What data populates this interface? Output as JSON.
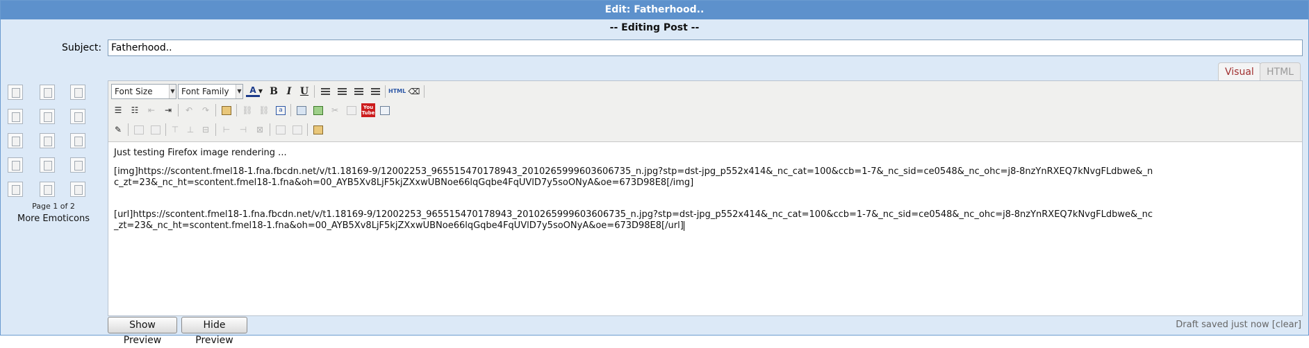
{
  "window": {
    "title": "Edit: Fatherhood.."
  },
  "header": {
    "subtitle": "-- Editing Post --"
  },
  "subject": {
    "label": "Subject:",
    "value": "Fatherhood.."
  },
  "tabs": [
    {
      "label": "Visual",
      "active": true
    },
    {
      "label": "HTML",
      "active": false
    }
  ],
  "emoticons": {
    "page_info": "Page 1 of 2",
    "more_label": "More Emoticons"
  },
  "toolbar": {
    "font_size": "Font Size",
    "font_family": "Font Family",
    "bold": "B",
    "italic": "I",
    "underline": "U",
    "html_label": "HTML",
    "youtube_top": "You",
    "youtube_bottom": "Tube",
    "text_color_letter": "A"
  },
  "editor": {
    "line1": "Just testing Firefox image rendering ...",
    "img_line": "[img]https://scontent.fmel18-1.fna.fbcdn.net/v/t1.18169-9/12002253_965515470178943_2010265999603606735_n.jpg?stp=dst-jpg_p552x414&_nc_cat=100&ccb=1-7&_nc_sid=ce0548&_nc_ohc=j8-8nzYnRXEQ7kNvgFLdbwe&_nc_zt=23&_nc_ht=scontent.fmel18-1.fna&oh=00_AYB5Xv8LjF5kjZXxwUBNoe66lqGqbe4FqUVlD7y5soONyA&oe=673D98E8[/img]",
    "url_line": "[url]https://scontent.fmel18-1.fna.fbcdn.net/v/t1.18169-9/12002253_965515470178943_2010265999603606735_n.jpg?stp=dst-jpg_p552x414&_nc_cat=100&ccb=1-7&_nc_sid=ce0548&_nc_ohc=j8-8nzYnRXEQ7kNvgFLdbwe&_nc_zt=23&_nc_ht=scontent.fmel18-1.fna&oh=00_AYB5Xv8LjF5kjZXxwUBNoe66lqGqbe4FqUVlD7y5soONyA&oe=673D98E8[/url]"
  },
  "buttons": {
    "show_preview": "Show Preview",
    "hide_preview": "Hide Preview"
  },
  "status": {
    "draft": "Draft saved just now [clear]"
  }
}
